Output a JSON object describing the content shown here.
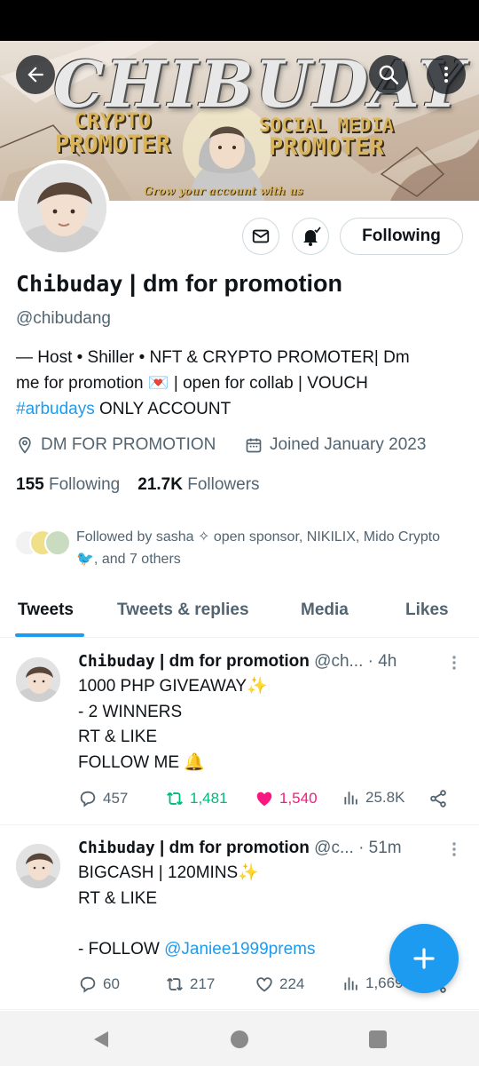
{
  "banner": {
    "title": "CHIBUDAY",
    "left_line1": "CRYPTO",
    "left_line2": "PROMOTER",
    "right_line1": "SOCIAL MEDIA",
    "right_line2": "PROMOTER",
    "tagline": "Grow your account with us"
  },
  "nav": {
    "back_icon": "arrow-left-icon",
    "search_icon": "search-icon",
    "more_icon": "more-vertical-icon"
  },
  "profile": {
    "name_mono": "Chibuday",
    "name_rest": " | dm for promotion",
    "handle": "@chibudang",
    "bio_line1": "— Host • Shiller • NFT & CRYPTO PROMOTER| Dm",
    "bio_line2a": "me for promotion ",
    "bio_emoji": "💌",
    "bio_line2b": " | open for collab | VOUCH",
    "bio_hashtag": "#arbudays",
    "bio_line3": " ONLY ACCOUNT",
    "location": "DM FOR PROMOTION",
    "joined": "Joined January 2023",
    "following_count": "155",
    "following_label": "Following",
    "followers_count": "21.7K",
    "followers_label": "Followers",
    "followed_by_text": "Followed by sasha ✧ open sponsor, NIKILIX, Mido Crypto",
    "followed_by_bird": "🐦",
    "followed_by_rest": ", and 7 others"
  },
  "actions": {
    "following_button": "Following"
  },
  "tabs": [
    "Tweets",
    "Tweets & replies",
    "Media",
    "Likes"
  ],
  "tweets": [
    {
      "name_mono": "Chibuday",
      "name_rest": " | dm for promotion",
      "handle_time": " @ch... · 4h",
      "text": "1000 PHP GIVEAWAY✨\n- 2 WINNERS\nRT & LIKE\nFOLLOW ME 🔔",
      "replies": "457",
      "retweets": "1,481",
      "likes": "1,540",
      "views": "25.8K"
    },
    {
      "name_mono": "Chibuday",
      "name_rest": " | dm for promotion",
      "handle_time": " @c... · 51m",
      "text_lines": "BIGCASH | 120MINS✨\nRT & LIKE\n\n- FOLLOW ",
      "mention": "@Janiee1999prems",
      "replies": "60",
      "retweets": "217",
      "likes": "224",
      "views": "1,669"
    }
  ],
  "colors": {
    "accent": "#1d9bf0",
    "retweet": "#00ba7c",
    "like": "#f91880",
    "muted": "#536471"
  }
}
